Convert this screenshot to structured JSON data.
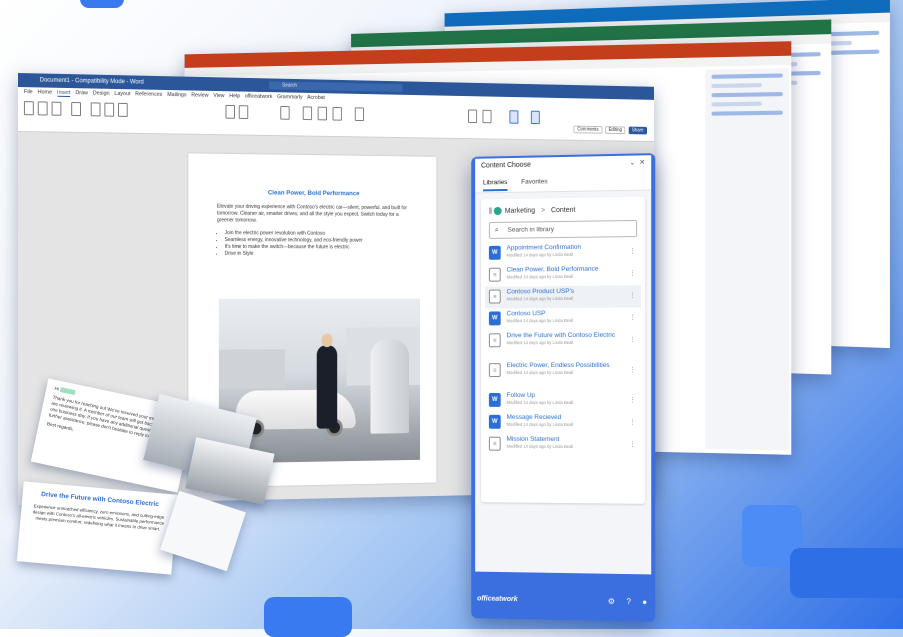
{
  "word": {
    "title": "Document1 - Compatibility Mode - Word",
    "search_placeholder": "Search",
    "menu": [
      "File",
      "Home",
      "Insert",
      "Draw",
      "Design",
      "Layout",
      "References",
      "Mailings",
      "Review",
      "View",
      "Help",
      "officeatwork",
      "Grammarly",
      "Acrobat"
    ],
    "comments_btn": "Comments",
    "editing_btn": "Editing",
    "share_btn": "Share"
  },
  "document": {
    "heading": "Clean Power, Bold Performance",
    "intro": "Elevate your driving experience with Contoso's electric car—silent, powerful, and built for tomorrow. Cleaner air, smarter drives, and all the style you expect. Switch today for a greener tomorrow.",
    "bullets": [
      "Join the electric power revolution with Contoso",
      "Seamless energy, innovative technology, and eco-friendly power",
      "It's time to make the switch—because the future is electric",
      "Drive in Style"
    ]
  },
  "chooser": {
    "title": "Content Choose",
    "tabs": [
      "Libraries",
      "Favorites"
    ],
    "breadcrumb_root": "Marketing",
    "breadcrumb_sep": ">",
    "breadcrumb_leaf": "Content",
    "search_placeholder": "Search in library",
    "items": [
      {
        "title": "Appointment Confirmation",
        "meta": "Modified 14 days ago by Linda Beall",
        "icon": "word"
      },
      {
        "title": "Clean Power, Bold Performance",
        "meta": "Modified 14 days ago by Linda Beall",
        "icon": "doc"
      },
      {
        "title": "Contoso Product USP's",
        "meta": "Modified 14 days ago by Linda Beall",
        "icon": "doc"
      },
      {
        "title": "Contoso USP",
        "meta": "Modified 14 days ago by Linda Beall",
        "icon": "word"
      },
      {
        "title": "Drive the Future with Contoso Electric",
        "meta": "Modified 14 days ago by Linda Beall",
        "icon": "doc"
      },
      {
        "title": "Electric Power, Endless Possibilities",
        "meta": "Modified 14 days ago by Linda Beall",
        "icon": "doc"
      },
      {
        "title": "Follow Up",
        "meta": "Modified 14 days ago by Linda Beall",
        "icon": "word"
      },
      {
        "title": "Message Recieved",
        "meta": "Modified 14 days ago by Linda Beall",
        "icon": "word"
      },
      {
        "title": "Mission Statement",
        "meta": "Modified 14 days ago by Linda Beall",
        "icon": "doc"
      }
    ],
    "footer_brand": "officeatwork"
  },
  "cards": {
    "email_greeting": "Hi",
    "email_body": "Thank you for reaching out We've received your message and are reviewing it. A member of our team will get back to you within one business day. If you have any additional questions or need further assistance, please don't hesitate to reply to this email.",
    "email_signoff": "Best regards,",
    "slide_title": "Drive the Future with Contoso Electric",
    "slide_body": "Experience unmatched efficiency, zero emissions, and cutting-edge design with Contoso's all-electric vehicles. Sustainable performance meets premium comfort, redefining what it means to drive smart."
  },
  "colors": {
    "word": "#2b579a",
    "powerpoint": "#c43e1c",
    "excel": "#217346",
    "outlook": "#0f6cbd",
    "accent": "#2b6fd6"
  }
}
